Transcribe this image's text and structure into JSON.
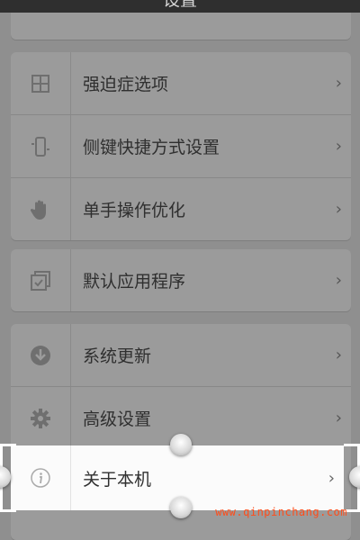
{
  "header": {
    "title": "设置"
  },
  "groups": [
    {
      "items": [
        {
          "label": "强迫症选项",
          "icon": "grid-icon"
        },
        {
          "label": "侧键快捷方式设置",
          "icon": "phone-side-keys-icon"
        },
        {
          "label": "单手操作优化",
          "icon": "hand-icon"
        }
      ]
    },
    {
      "items": [
        {
          "label": "默认应用程序",
          "icon": "default-app-icon"
        }
      ]
    },
    {
      "items": [
        {
          "label": "系统更新",
          "icon": "download-icon"
        },
        {
          "label": "高级设置",
          "icon": "gear-icon"
        },
        {
          "label": "关于本机",
          "icon": "info-icon"
        }
      ]
    }
  ],
  "chevron": "›",
  "watermark": "www.qinpinchang.com"
}
